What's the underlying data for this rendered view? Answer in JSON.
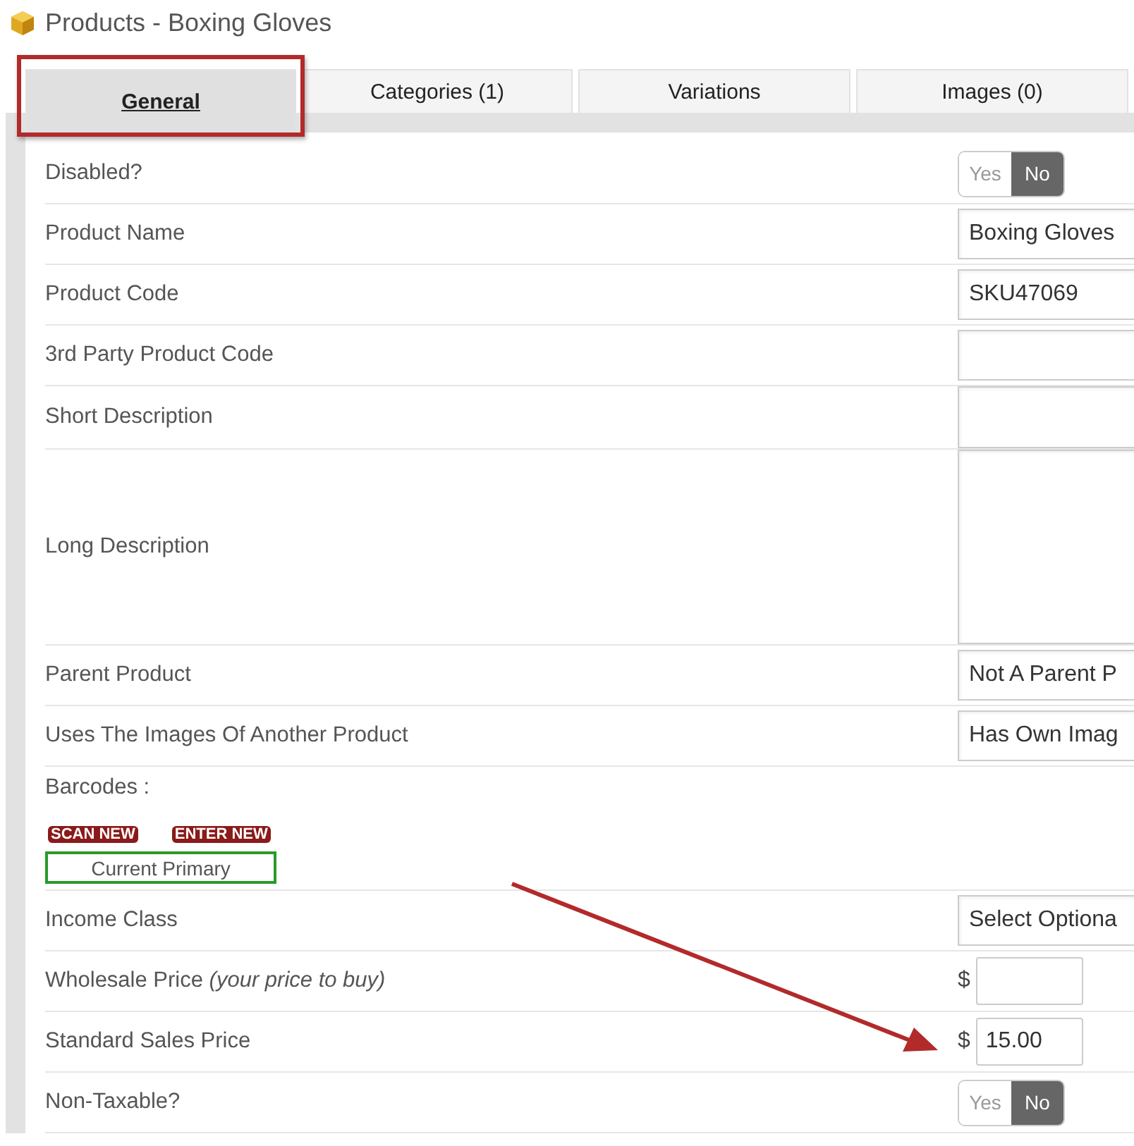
{
  "page_title": "Products - Boxing Gloves",
  "tabs": [
    {
      "label": "General",
      "selected": true
    },
    {
      "label": "Categories (1)",
      "selected": false
    },
    {
      "label": "Variations",
      "selected": false
    },
    {
      "label": "Images (0)",
      "selected": false
    }
  ],
  "fields": [
    {
      "kind": "toggle",
      "label": "Disabled?",
      "options": [
        {
          "label": "Yes",
          "selected": false
        },
        {
          "label": "No",
          "selected": true
        }
      ]
    },
    {
      "kind": "text",
      "label": "Product Name",
      "value": "Boxing Gloves"
    },
    {
      "kind": "text",
      "label": "Product Code",
      "value": "SKU47069"
    },
    {
      "kind": "text",
      "label": "3rd Party Product Code"
    },
    {
      "kind": "short_textarea",
      "label": "Short Description"
    },
    {
      "kind": "textarea",
      "label": "Long Description"
    },
    {
      "kind": "select",
      "label": "Parent Product",
      "value": "Not A Parent P"
    },
    {
      "kind": "select",
      "label": "Uses The Images Of Another Product",
      "value": "Has Own Imag"
    },
    {
      "kind": "barcodes",
      "label": "Barcodes :",
      "actions": [
        "SCAN NEW",
        "ENTER NEW"
      ],
      "primary": "Current Primary"
    },
    {
      "kind": "select",
      "label": "Income Class",
      "value": "Select Optiona"
    },
    {
      "kind": "price",
      "label": "Wholesale Price *(your price to buy)*",
      "currency": "$"
    },
    {
      "kind": "price",
      "label": "Standard Sales Price",
      "currency": "$",
      "value": "15.00"
    },
    {
      "kind": "toggle",
      "label": "Non-Taxable?",
      "options": [
        {
          "label": "Yes",
          "selected": false
        },
        {
          "label": "No",
          "selected": true
        }
      ]
    }
  ]
}
